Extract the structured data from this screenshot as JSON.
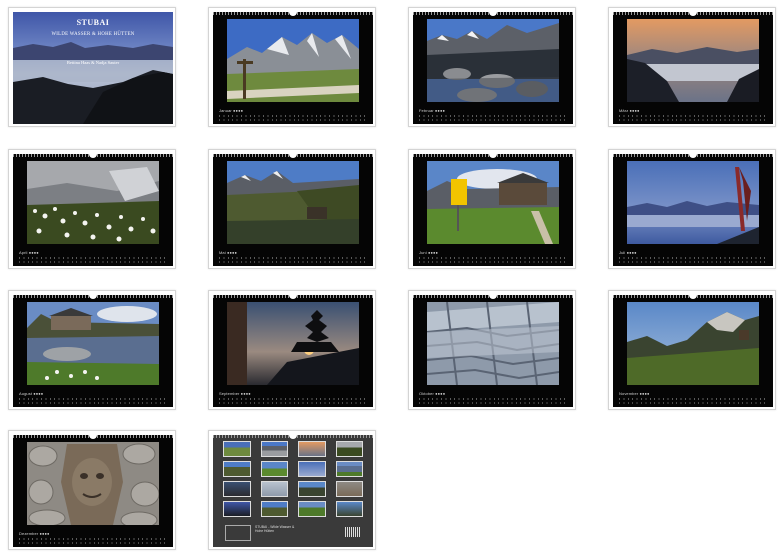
{
  "cover": {
    "title": "STUBAI",
    "subtitle": "WILDE WASSER & HOHE HÜTTEN",
    "authors": "Bettina Haas & Nadja Sauter"
  },
  "months": [
    {
      "label": "Januar ●●●●"
    },
    {
      "label": "Februar ●●●●"
    },
    {
      "label": "März ●●●●"
    },
    {
      "label": "April ●●●●"
    },
    {
      "label": "Mai ●●●●"
    },
    {
      "label": "Juni ●●●●"
    },
    {
      "label": "Juli ●●●●"
    },
    {
      "label": "August ●●●●"
    },
    {
      "label": "September ●●●●"
    },
    {
      "label": "Oktober ●●●●"
    },
    {
      "label": "November ●●●●"
    },
    {
      "label": "Dezember ●●●●"
    }
  ],
  "back": {
    "info": "STUBAI - Wilde Wasser & Hohe Hütten"
  },
  "colors": {
    "background": "#ffffff",
    "page": "#050505",
    "back_page": "#3a3a3a",
    "card_border": "#d4d4d4"
  }
}
